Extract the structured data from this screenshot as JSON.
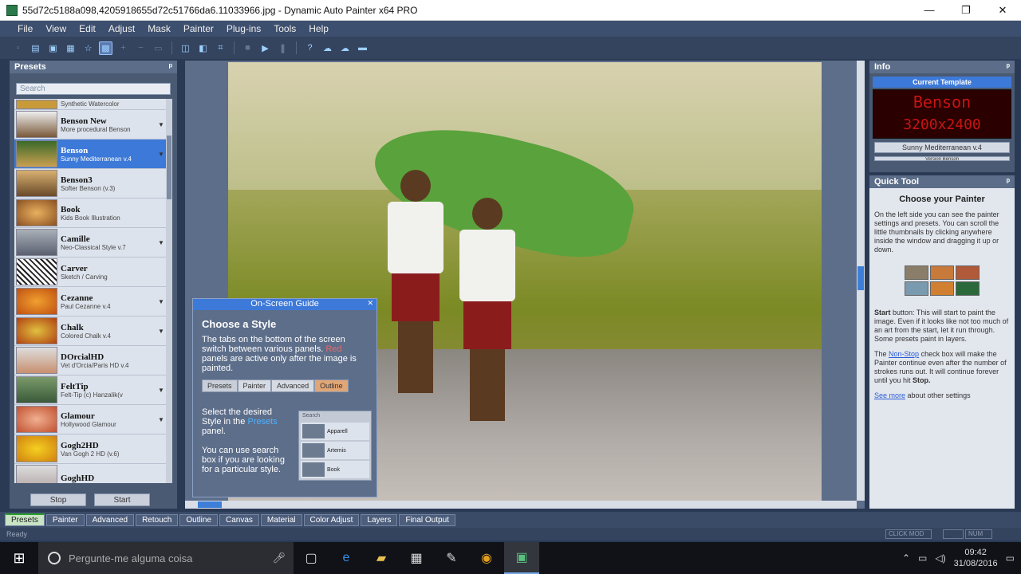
{
  "window": {
    "title": "55d72c5188a098,4205918655d72c51766da6.11033966.jpg - Dynamic Auto Painter x64 PRO",
    "minimize": "—",
    "restore": "❐",
    "close": "✕"
  },
  "menu": [
    "File",
    "View",
    "Edit",
    "Adjust",
    "Mask",
    "Painter",
    "Plug-ins",
    "Tools",
    "Help"
  ],
  "presets_panel": {
    "title": "Presets",
    "pin": "ᵖ",
    "search_placeholder": "Search",
    "items": [
      {
        "name": "",
        "desc": "Synthetic Watercolor"
      },
      {
        "name": "Benson New",
        "desc": "More procedural Benson"
      },
      {
        "name": "Benson",
        "desc": "Sunny Mediterranean v.4"
      },
      {
        "name": "Benson3",
        "desc": "Softer Benson (v.3)"
      },
      {
        "name": "Book",
        "desc": "Kids Book Illustration"
      },
      {
        "name": "Camille",
        "desc": "Neo-Classical Style v.7"
      },
      {
        "name": "Carver",
        "desc": "Sketch / Carving"
      },
      {
        "name": "Cezanne",
        "desc": "Paul Cezanne v.4"
      },
      {
        "name": "Chalk",
        "desc": "Colored Chalk v.4"
      },
      {
        "name": "DOrcialHD",
        "desc": "Vet d'Orcia/Paris HD v.4"
      },
      {
        "name": "FeltTip",
        "desc": "Felt-Tip (c) Hanzalik(v"
      },
      {
        "name": "Glamour",
        "desc": "Hollywood Glamour"
      },
      {
        "name": "Gogh2HD",
        "desc": "Van Gogh 2 HD (v.6)"
      },
      {
        "name": "GoghHD",
        "desc": ""
      }
    ],
    "stop_label": "Stop",
    "start_label": "Start"
  },
  "guide": {
    "header": "On-Screen Guide",
    "title": "Choose a Style",
    "para1_a": "The tabs on the bottom of the screen switch between various panels.",
    "para1_red": "Red",
    "para1_b": "panels are active only after the image is painted.",
    "tabs": [
      "Presets",
      "Painter",
      "Advanced",
      "Outline"
    ],
    "para2_a": "Select the desired Style in the",
    "para2_link": "Presets",
    "para2_b": "panel.",
    "para3": "You can use search box if you are looking for a particular style.",
    "mini_search": "Search",
    "mini_rows": [
      "Apparell",
      "Artemis",
      "Book"
    ]
  },
  "info_panel": {
    "title": "Info",
    "current_template": "Current Template",
    "led_line1": "Benson",
    "led_line2": "3200x2400",
    "style_field": "Sunny Mediterranean v.4",
    "field2": "Version Benson"
  },
  "quick_tool": {
    "title": "Quick Tool",
    "heading": "Choose your Painter",
    "text1": "On the left side you can see the painter settings and presets. You can scroll the little thumbnails by clicking anywhere inside the window and dragging it up or down.",
    "start_head": "Start",
    "start_text": "button: This will start to paint the image. Even if it looks like not too much of an art from the start, let it run through. Some presets paint in layers.",
    "nonstop_pre": "The",
    "nonstop_link": "Non-Stop",
    "nonstop_text": "check box will make the Painter continue even after the number of strokes runs out. It will continue forever until you hit",
    "nonstop_stop": "Stop.",
    "see_more_link": "See more",
    "see_more_text": "about other settings"
  },
  "bottom_tabs": [
    "Presets",
    "Painter",
    "Advanced",
    "Retouch",
    "Outline",
    "Canvas",
    "Material",
    "Color Adjust",
    "Layers",
    "Final Output"
  ],
  "status": {
    "text": "Ready",
    "box1": "CLICK MOD",
    "box3": "NUM"
  },
  "taskbar": {
    "search_placeholder": "Pergunte-me alguma coisa",
    "time": "09:42",
    "date": "31/08/2016"
  }
}
